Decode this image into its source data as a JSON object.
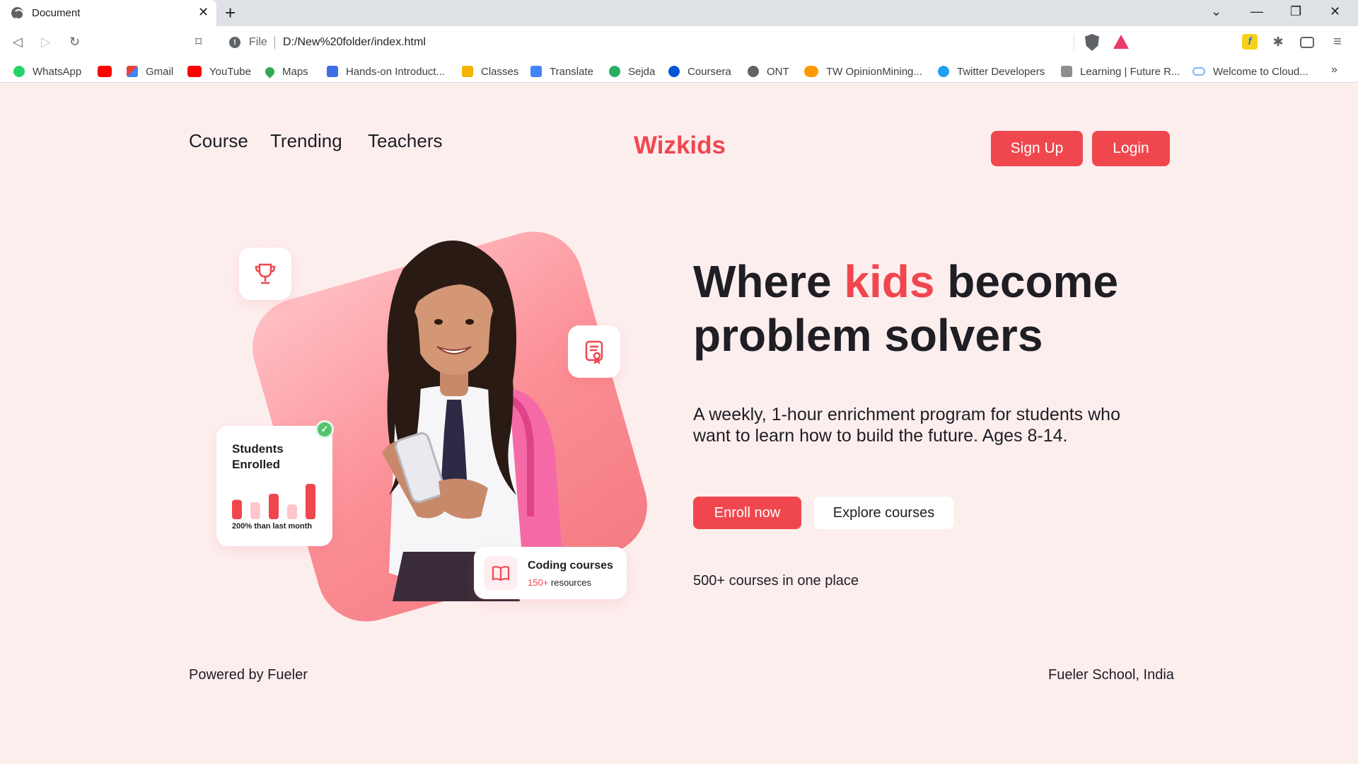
{
  "browser": {
    "tab_title": "Document",
    "close_glyph": "✕",
    "new_tab_glyph": "+",
    "url_scheme": "File",
    "url": "D:/New%20folder/index.html",
    "bookmarks": [
      {
        "label": "WhatsApp",
        "color": "#25d366"
      },
      {
        "label": "",
        "color": "#ff0000"
      },
      {
        "label": "Gmail",
        "color": "#ea4335"
      },
      {
        "label": "YouTube",
        "color": "#ff0000"
      },
      {
        "label": "Maps",
        "color": "#34a853"
      },
      {
        "label": "Hands-on Introduct...",
        "color": "#3b6ee8"
      },
      {
        "label": "Classes",
        "color": "#f4b400"
      },
      {
        "label": "Translate",
        "color": "#4285f4"
      },
      {
        "label": "Sejda",
        "color": "#27ae60"
      },
      {
        "label": "Coursera",
        "color": "#0056d2"
      },
      {
        "label": "ONT",
        "color": "#5f6368"
      },
      {
        "label": "TW OpinionMining...",
        "color": "#ff9800"
      },
      {
        "label": "Twitter Developers",
        "color": "#1da1f2"
      },
      {
        "label": "Learning | Future R...",
        "color": "#8e8e8e"
      },
      {
        "label": "Welcome to Cloud...",
        "color": "#7ab8f5"
      }
    ],
    "more_bookmarks": "»"
  },
  "nav": {
    "links": [
      "Course",
      "Trending",
      "Teachers"
    ],
    "brand": "Wizkids",
    "signup": "Sign Up",
    "login": "Login"
  },
  "hero": {
    "headline_pre": "Where ",
    "headline_accent": "kids",
    "headline_post": " become",
    "headline_line2": "problem solvers",
    "subtext": "A weekly, 1-hour enrichment program for students who want to learn how to build the future. Ages 8-14.",
    "enroll": "Enroll now",
    "explore": "Explore courses",
    "courses_count": "500+ courses in one place"
  },
  "cards": {
    "students_title_line1": "Students",
    "students_title_line2": "Enrolled",
    "students_note": "200% than last month",
    "students_bars": [
      0.55,
      0.48,
      0.72,
      0.42,
      1.0
    ],
    "coding_title": "Coding courses",
    "coding_count": "150+",
    "coding_suffix": " resources"
  },
  "footer": {
    "left": "Powered by Fueler",
    "right": "Fueler School, India"
  },
  "colors": {
    "accent": "#f0474f",
    "page_bg": "#fdeeee"
  }
}
